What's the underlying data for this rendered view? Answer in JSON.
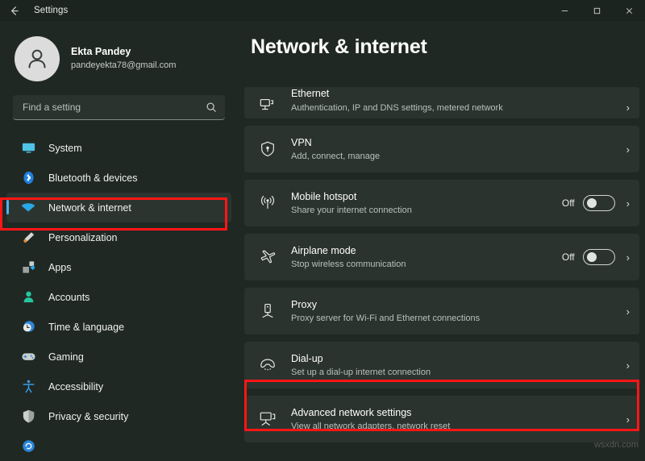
{
  "window": {
    "back_label": "back-arrow",
    "title": "Settings",
    "minimize": "–",
    "maximize": "□",
    "close": "×"
  },
  "account": {
    "name": "Ekta Pandey",
    "email": "pandeyekta78@gmail.com",
    "avatar_icon": "person-icon"
  },
  "search": {
    "placeholder": "Find a setting",
    "icon": "search-icon"
  },
  "sidebar": {
    "items": [
      {
        "label": "System",
        "icon": "monitor-icon",
        "selected": false
      },
      {
        "label": "Bluetooth & devices",
        "icon": "bluetooth-icon",
        "selected": false
      },
      {
        "label": "Network & internet",
        "icon": "wifi-icon",
        "selected": true
      },
      {
        "label": "Personalization",
        "icon": "paintbrush-icon",
        "selected": false
      },
      {
        "label": "Apps",
        "icon": "apps-icon",
        "selected": false
      },
      {
        "label": "Accounts",
        "icon": "account-icon",
        "selected": false
      },
      {
        "label": "Time & language",
        "icon": "clock-globe-icon",
        "selected": false
      },
      {
        "label": "Gaming",
        "icon": "gamepad-icon",
        "selected": false
      },
      {
        "label": "Accessibility",
        "icon": "accessibility-icon",
        "selected": false
      },
      {
        "label": "Privacy & security",
        "icon": "shield-icon",
        "selected": false
      }
    ]
  },
  "main": {
    "title": "Network & internet",
    "rows": [
      {
        "title": "Ethernet",
        "subtitle": "Authentication, IP and DNS settings, metered network",
        "icon": "ethernet-icon",
        "clipped": true,
        "toggle": null
      },
      {
        "title": "VPN",
        "subtitle": "Add, connect, manage",
        "icon": "vpn-shield-icon",
        "clipped": false,
        "toggle": null
      },
      {
        "title": "Mobile hotspot",
        "subtitle": "Share your internet connection",
        "icon": "hotspot-icon",
        "clipped": false,
        "toggle": "Off"
      },
      {
        "title": "Airplane mode",
        "subtitle": "Stop wireless communication",
        "icon": "airplane-icon",
        "clipped": false,
        "toggle": "Off"
      },
      {
        "title": "Proxy",
        "subtitle": "Proxy server for Wi-Fi and Ethernet connections",
        "icon": "proxy-server-icon",
        "clipped": false,
        "toggle": null
      },
      {
        "title": "Dial-up",
        "subtitle": "Set up a dial-up internet connection",
        "icon": "dialup-phone-icon",
        "clipped": false,
        "toggle": null
      },
      {
        "title": "Advanced network settings",
        "subtitle": "View all network adapters, network reset",
        "icon": "advanced-network-icon",
        "clipped": false,
        "toggle": null
      }
    ],
    "chevron": "›"
  },
  "annotations": {
    "color": "#ff1616",
    "targets": [
      "Network & internet",
      "Advanced network settings"
    ]
  },
  "watermark": "wsxdn.com"
}
